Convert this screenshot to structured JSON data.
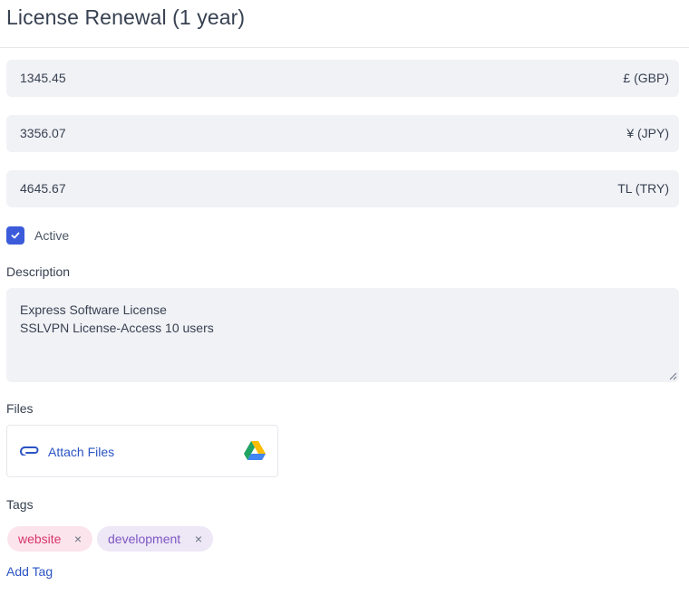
{
  "title": "License Renewal (1 year)",
  "prices": [
    {
      "value": "1345.45",
      "currency": "£ (GBP)"
    },
    {
      "value": "3356.07",
      "currency": "¥ (JPY)"
    },
    {
      "value": "4645.67",
      "currency": "TL (TRY)"
    }
  ],
  "active": {
    "checked": true,
    "label": "Active"
  },
  "description": {
    "label": "Description",
    "lines": [
      "Express Software License",
      "SSLVPN License-Access 10 users"
    ]
  },
  "files": {
    "label": "Files",
    "attach_label": "Attach Files",
    "icons": [
      "paperclip-icon",
      "google-drive-icon"
    ]
  },
  "tags": {
    "label": "Tags",
    "items": [
      {
        "text": "website",
        "remove": "×",
        "color": "#d6366c",
        "bg": "#fce4ec"
      },
      {
        "text": "development",
        "remove": "×",
        "color": "#7e57c2",
        "bg": "#ede7f6"
      }
    ],
    "add_label": "Add Tag"
  },
  "colors": {
    "accent": "#3b5bdb",
    "link": "#2b54c4",
    "field_bg": "#f1f2f6"
  }
}
